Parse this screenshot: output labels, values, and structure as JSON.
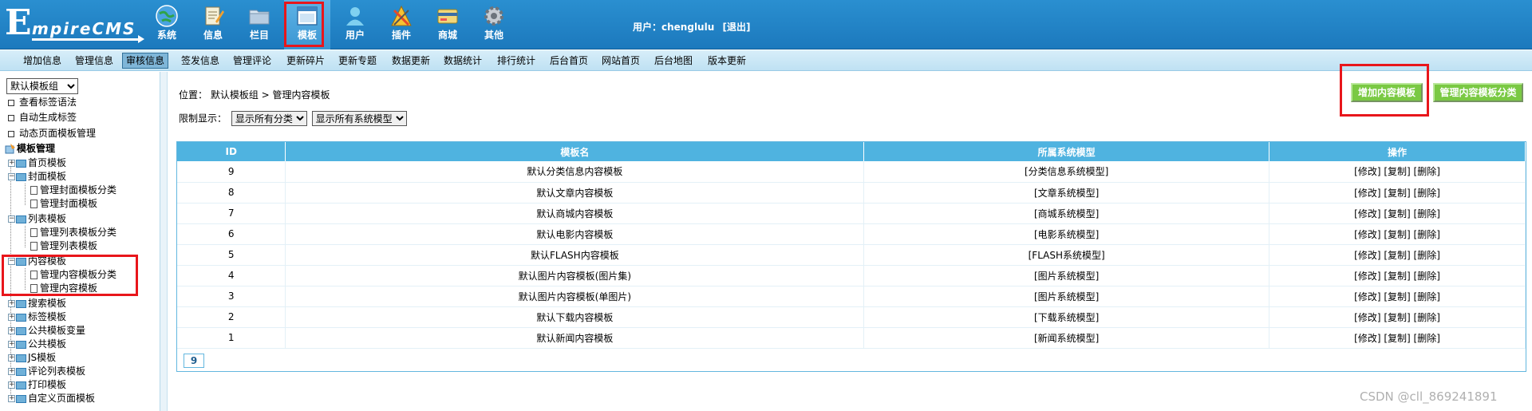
{
  "logo": {
    "big": "E",
    "rest": "mpireCMS"
  },
  "nav": [
    {
      "label": "系统",
      "icon": "globe-icon"
    },
    {
      "label": "信息",
      "icon": "notepad-icon"
    },
    {
      "label": "栏目",
      "icon": "folder-icon"
    },
    {
      "label": "模板",
      "icon": "template-window-icon"
    },
    {
      "label": "用户",
      "icon": "user-icon"
    },
    {
      "label": "插件",
      "icon": "tools-icon"
    },
    {
      "label": "商城",
      "icon": "shop-card-icon"
    },
    {
      "label": "其他",
      "icon": "gear-icon"
    }
  ],
  "user": {
    "prefix": "用户：",
    "name": "chenglulu",
    "logout": "[退出]"
  },
  "submenu": [
    "增加信息",
    "管理信息",
    "审核信息",
    "签发信息",
    "管理评论",
    "更新碎片",
    "更新专题",
    "数据更新",
    "数据统计",
    "排行统计",
    "后台首页",
    "网站首页",
    "后台地图",
    "版本更新"
  ],
  "submenu_active": "审核信息",
  "left": {
    "group_select": "默认模板组",
    "links": [
      "查看标签语法",
      "自动生成标签",
      "动态页面模板管理"
    ],
    "tree_title": "模板管理",
    "tree": [
      "首页模板",
      "封面模板",
      "管理封面模板分类",
      "管理封面模板",
      "列表模板",
      "管理列表模板分类",
      "管理列表模板",
      "内容模板",
      "管理内容模板分类",
      "管理内容模板",
      "搜索模板",
      "标签模板",
      "公共模板变量",
      "公共模板",
      "JS模板",
      "评论列表模板",
      "打印模板",
      "自定义页面模板"
    ]
  },
  "location": {
    "label": "位置：",
    "crumb1": "默认模板组",
    "sep": " > ",
    "crumb2": "管理内容模板"
  },
  "filter": {
    "label": "限制显示：",
    "cat_select": "显示所有分类",
    "model_select": "显示所有系统模型"
  },
  "buttons": {
    "add": "增加内容模板",
    "manage_cat": "管理内容模板分类"
  },
  "table": {
    "headers": [
      "ID",
      "模板名",
      "所属系统模型",
      "操作"
    ],
    "rows": [
      {
        "id": "9",
        "name": "默认分类信息内容模板",
        "model": "[分类信息系统模型]"
      },
      {
        "id": "8",
        "name": "默认文章内容模板",
        "model": "[文章系统模型]"
      },
      {
        "id": "7",
        "name": "默认商城内容模板",
        "model": "[商城系统模型]"
      },
      {
        "id": "6",
        "name": "默认电影内容模板",
        "model": "[电影系统模型]"
      },
      {
        "id": "5",
        "name": "默认FLASH内容模板",
        "model": "[FLASH系统模型]"
      },
      {
        "id": "4",
        "name": "默认图片内容模板(图片集)",
        "model": "[图片系统模型]"
      },
      {
        "id": "3",
        "name": "默认图片内容模板(单图片)",
        "model": "[图片系统模型]"
      },
      {
        "id": "2",
        "name": "默认下载内容模板",
        "model": "[下载系统模型]"
      },
      {
        "id": "1",
        "name": "默认新闻内容模板",
        "model": "[新闻系统模型]"
      }
    ],
    "ops": {
      "edit": "[修改]",
      "copy": "[复制]",
      "delete": "[删除]"
    },
    "total": "9"
  },
  "watermark": "CSDN @cll_869241891",
  "colors": {
    "header": "#1f7fc2",
    "accent_red": "#e8161b",
    "button_green": "#7ac943",
    "table_head": "#4fb3e0"
  }
}
